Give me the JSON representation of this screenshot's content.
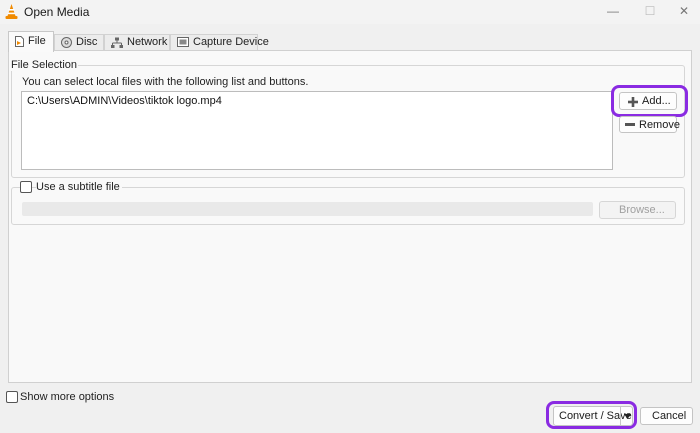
{
  "window": {
    "title": "Open Media",
    "controls": {
      "minimize": "—",
      "maximize": "☐",
      "close": "✕"
    }
  },
  "tabs": [
    {
      "label": "File",
      "icon": "file-icon",
      "active": true
    },
    {
      "label": "Disc",
      "icon": "disc-icon",
      "active": false
    },
    {
      "label": "Network",
      "icon": "network-icon",
      "active": false
    },
    {
      "label": "Capture Device",
      "icon": "capture-device-icon",
      "active": false
    }
  ],
  "file_selection": {
    "group_title": "File Selection",
    "description": "You can select local files with the following list and buttons.",
    "files": [
      "C:\\Users\\ADMIN\\Videos\\tiktok logo.mp4"
    ],
    "add_label": "Add...",
    "remove_label": "Remove"
  },
  "subtitle": {
    "checkbox_label": "Use a subtitle file",
    "checked": false,
    "browse_label": "Browse..."
  },
  "footer": {
    "show_more_label": "Show more options",
    "show_more_checked": false,
    "convert_label": "Convert / Save",
    "cancel_label": "Cancel"
  },
  "colors": {
    "highlight": "#8a2be2",
    "vlc_orange": "#f08a00"
  }
}
